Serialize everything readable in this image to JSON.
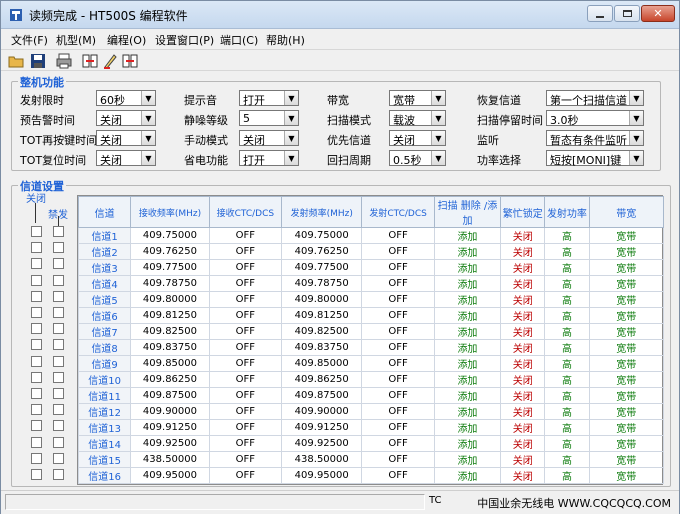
{
  "window": {
    "title": "读频完成 - HT500S 编程软件",
    "buttons": [
      "minimize",
      "maximize",
      "close"
    ]
  },
  "menu": [
    "文件(F)",
    "机型(M)",
    "编程(O)",
    "设置窗口(P)",
    "端口(C)",
    "帮助(H)"
  ],
  "toolbar": {
    "icons": [
      "open-icon",
      "save-icon",
      "print-icon",
      "read-icon",
      "write-icon",
      "port-icon"
    ]
  },
  "machine": {
    "title": "整机功能",
    "fields": [
      {
        "label": "发射限时",
        "value": "60秒"
      },
      {
        "label": "提示音",
        "value": "打开"
      },
      {
        "label": "带宽",
        "value": "宽带"
      },
      {
        "label": "恢复信道",
        "value": "第一个扫描信道"
      },
      {
        "label": "预告警时间",
        "value": "关闭"
      },
      {
        "label": "静噪等级",
        "value": "5"
      },
      {
        "label": "扫描模式",
        "value": "载波"
      },
      {
        "label": "扫描停留时间",
        "value": "3.0秒"
      },
      {
        "label": "TOT再按键时间",
        "value": "关闭"
      },
      {
        "label": "手动模式",
        "value": "关闭"
      },
      {
        "label": "优先信道",
        "value": "关闭"
      },
      {
        "label": "监听",
        "value": "暂态有条件监听"
      },
      {
        "label": "TOT复位时间",
        "value": "关闭"
      },
      {
        "label": "省电功能",
        "value": "打开"
      },
      {
        "label": "回扫周期",
        "value": "0.5秒"
      },
      {
        "label": "功率选择",
        "value": "短按[MONI]键"
      }
    ]
  },
  "channels": {
    "title": "信道设置",
    "col_close": "关闭",
    "col_forbid": "禁发",
    "headers": [
      "信道",
      "接收频率(MHz)",
      "接收CTC/DCS",
      "发射频率(MHz)",
      "发射CTC/DCS",
      "扫描 删除 /添加",
      "繁忙锁定",
      "发射功率",
      "带宽"
    ],
    "rows": [
      [
        "信道1",
        "409.75000",
        "OFF",
        "409.75000",
        "OFF",
        "添加",
        "关闭",
        "高",
        "宽带"
      ],
      [
        "信道2",
        "409.76250",
        "OFF",
        "409.76250",
        "OFF",
        "添加",
        "关闭",
        "高",
        "宽带"
      ],
      [
        "信道3",
        "409.77500",
        "OFF",
        "409.77500",
        "OFF",
        "添加",
        "关闭",
        "高",
        "宽带"
      ],
      [
        "信道4",
        "409.78750",
        "OFF",
        "409.78750",
        "OFF",
        "添加",
        "关闭",
        "高",
        "宽带"
      ],
      [
        "信道5",
        "409.80000",
        "OFF",
        "409.80000",
        "OFF",
        "添加",
        "关闭",
        "高",
        "宽带"
      ],
      [
        "信道6",
        "409.81250",
        "OFF",
        "409.81250",
        "OFF",
        "添加",
        "关闭",
        "高",
        "宽带"
      ],
      [
        "信道7",
        "409.82500",
        "OFF",
        "409.82500",
        "OFF",
        "添加",
        "关闭",
        "高",
        "宽带"
      ],
      [
        "信道8",
        "409.83750",
        "OFF",
        "409.83750",
        "OFF",
        "添加",
        "关闭",
        "高",
        "宽带"
      ],
      [
        "信道9",
        "409.85000",
        "OFF",
        "409.85000",
        "OFF",
        "添加",
        "关闭",
        "高",
        "宽带"
      ],
      [
        "信道10",
        "409.86250",
        "OFF",
        "409.86250",
        "OFF",
        "添加",
        "关闭",
        "高",
        "宽带"
      ],
      [
        "信道11",
        "409.87500",
        "OFF",
        "409.87500",
        "OFF",
        "添加",
        "关闭",
        "高",
        "宽带"
      ],
      [
        "信道12",
        "409.90000",
        "OFF",
        "409.90000",
        "OFF",
        "添加",
        "关闭",
        "高",
        "宽带"
      ],
      [
        "信道13",
        "409.91250",
        "OFF",
        "409.91250",
        "OFF",
        "添加",
        "关闭",
        "高",
        "宽带"
      ],
      [
        "信道14",
        "409.92500",
        "OFF",
        "409.92500",
        "OFF",
        "添加",
        "关闭",
        "高",
        "宽带"
      ],
      [
        "信道15",
        "438.50000",
        "OFF",
        "438.50000",
        "OFF",
        "添加",
        "关闭",
        "高",
        "宽带"
      ],
      [
        "信道16",
        "409.95000",
        "OFF",
        "409.95000",
        "OFF",
        "添加",
        "关闭",
        "高",
        "宽带"
      ]
    ]
  },
  "status": {
    "left": "TC",
    "watermark": "中国业余无线电 WWW.CQCQCQ.COM"
  },
  "colors": {
    "accent": "#1f62d6",
    "green": "#0a7a0a",
    "red": "#b00000"
  }
}
